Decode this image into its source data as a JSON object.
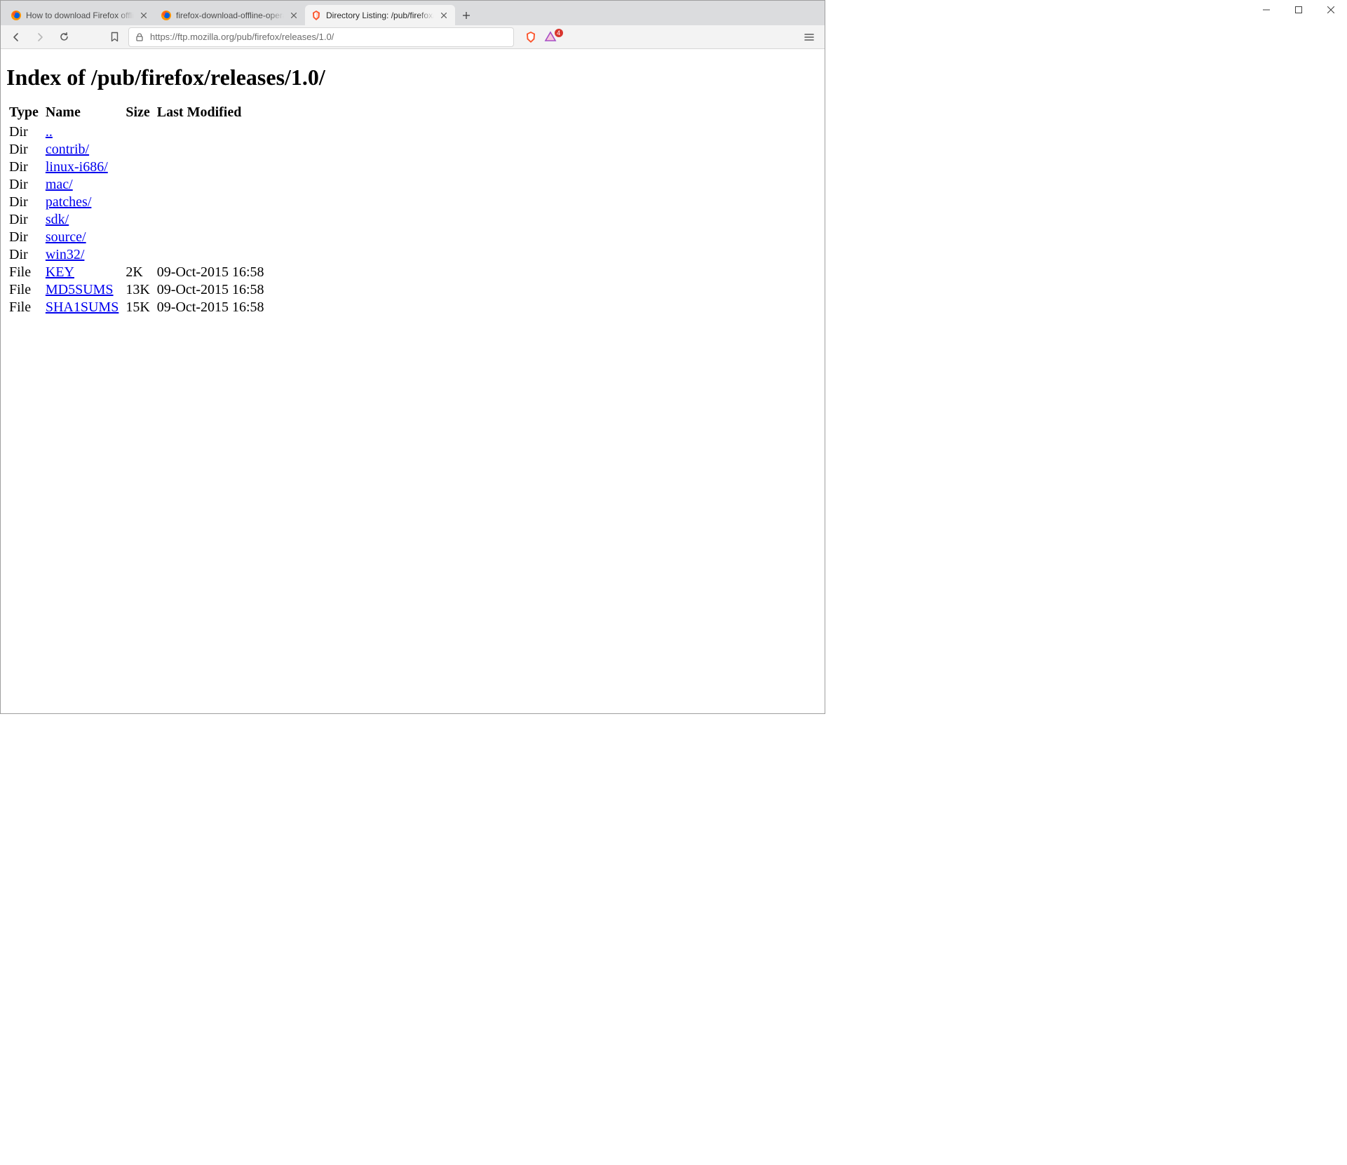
{
  "window": {
    "tabs": [
      {
        "title": "How to download Firefox offline in",
        "active": false,
        "favicon": "firefox-icon"
      },
      {
        "title": "firefox-download-offline-operatin",
        "active": false,
        "favicon": "firefox-icon"
      },
      {
        "title": "Directory Listing: /pub/firefox/rele",
        "active": true,
        "favicon": "brave-icon"
      }
    ],
    "url": "https://ftp.mozilla.org/pub/firefox/releases/1.0/",
    "badge_count": "4"
  },
  "page": {
    "heading": "Index of /pub/firefox/releases/1.0/",
    "columns": [
      "Type",
      "Name",
      "Size",
      "Last Modified"
    ],
    "rows": [
      {
        "type": "Dir",
        "name": "..",
        "size": "",
        "modified": ""
      },
      {
        "type": "Dir",
        "name": "contrib/",
        "size": "",
        "modified": ""
      },
      {
        "type": "Dir",
        "name": "linux-i686/",
        "size": "",
        "modified": ""
      },
      {
        "type": "Dir",
        "name": "mac/",
        "size": "",
        "modified": ""
      },
      {
        "type": "Dir",
        "name": "patches/",
        "size": "",
        "modified": ""
      },
      {
        "type": "Dir",
        "name": "sdk/",
        "size": "",
        "modified": ""
      },
      {
        "type": "Dir",
        "name": "source/",
        "size": "",
        "modified": ""
      },
      {
        "type": "Dir",
        "name": "win32/",
        "size": "",
        "modified": ""
      },
      {
        "type": "File",
        "name": "KEY",
        "size": "2K",
        "modified": "09-Oct-2015 16:58"
      },
      {
        "type": "File",
        "name": "MD5SUMS",
        "size": "13K",
        "modified": "09-Oct-2015 16:58"
      },
      {
        "type": "File",
        "name": "SHA1SUMS",
        "size": "15K",
        "modified": "09-Oct-2015 16:58"
      }
    ]
  }
}
